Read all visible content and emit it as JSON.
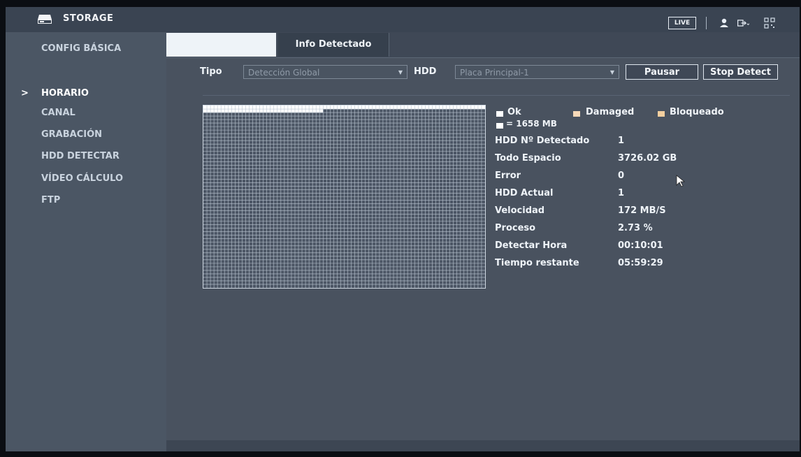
{
  "app": {
    "title": "STORAGE",
    "icon": "hdd-storage-icon"
  },
  "topbar": {
    "live_label": "LIVE",
    "icons": [
      "user-icon",
      "logout-icon",
      "qr-code-icon"
    ]
  },
  "sidebar": {
    "items": [
      {
        "label": "CONFIG BÁSICA",
        "active": false
      },
      {
        "label": "HORARIO",
        "active": true
      },
      {
        "label": "CANAL",
        "active": false
      },
      {
        "label": "GRABACIÓN",
        "active": false
      },
      {
        "label": "HDD DETECTAR",
        "active": false
      },
      {
        "label": "VÍDEO CÁLCULO",
        "active": false
      },
      {
        "label": "FTP",
        "active": false
      }
    ],
    "active_marker": ">"
  },
  "tabs": [
    {
      "label": "",
      "active": true
    },
    {
      "label": "Info Detectado",
      "active": false
    }
  ],
  "controls": {
    "tipo_label": "Tipo",
    "tipo_value": "Detección Global",
    "hdd_label": "HDD",
    "hdd_value": "Placa Principal-1",
    "pause_button": "Pausar",
    "stop_button": "Stop Detect"
  },
  "progress_grid": {
    "colors": {
      "ok": "#ffffff",
      "damaged": "#f7d9b8",
      "blocked": "#f3cf9f"
    },
    "scanned_fraction": 0.0273
  },
  "legend": {
    "ok": "Ok",
    "damaged": "Damaged",
    "blocked": "Bloqueado",
    "block_size": "= 1658 MB"
  },
  "info": [
    {
      "label": "HDD Nº Detectado",
      "value": "1"
    },
    {
      "label": "Todo Espacio",
      "value": "3726.02 GB"
    },
    {
      "label": "Error",
      "value": "0"
    },
    {
      "label": "HDD Actual",
      "value": "1"
    },
    {
      "label": "Velocidad",
      "value": "172 MB/S"
    },
    {
      "label": "Proceso",
      "value": "2.73 %"
    },
    {
      "label": "Detectar Hora",
      "value": "00:10:01"
    },
    {
      "label": "Tiempo restante",
      "value": "05:59:29"
    }
  ]
}
